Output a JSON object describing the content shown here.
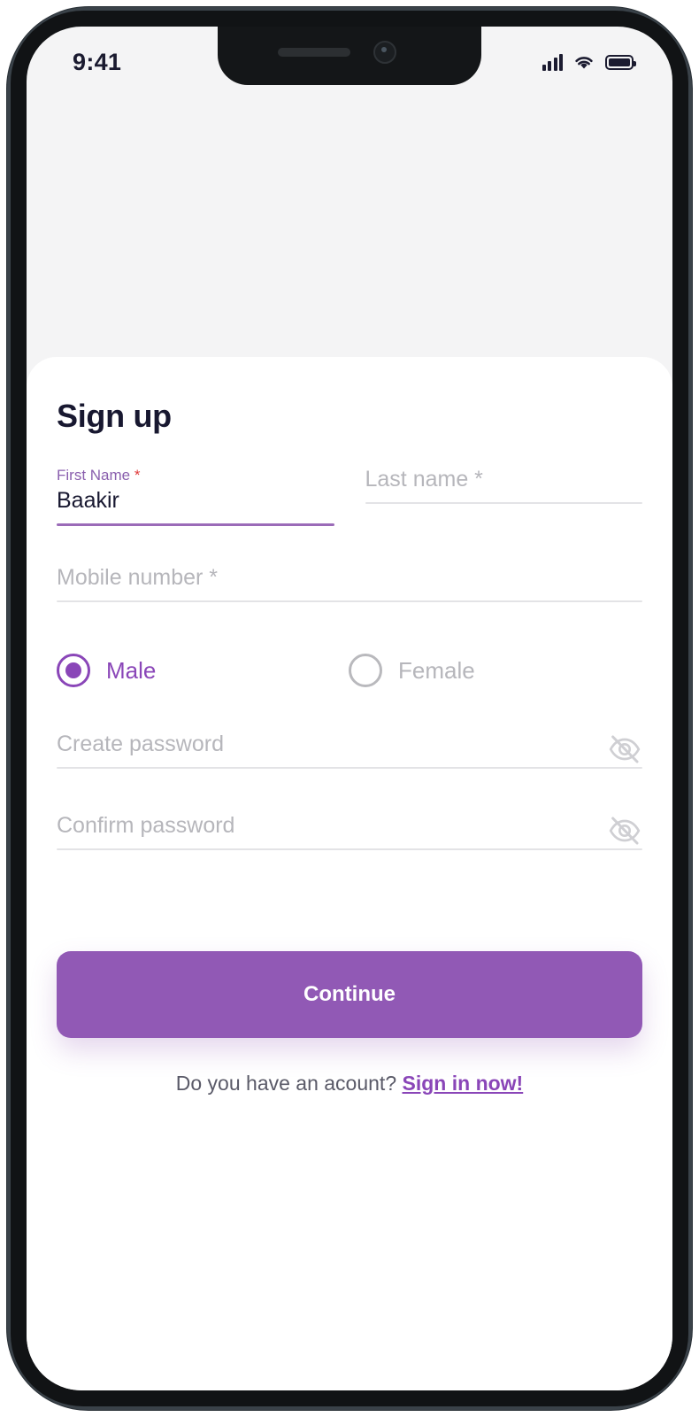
{
  "status_bar": {
    "time": "9:41",
    "signal_icon": "cellular-signal-icon",
    "wifi_icon": "wifi-icon",
    "battery_icon": "battery-full-icon"
  },
  "screen": {
    "title": "Sign up",
    "fields": {
      "first_name": {
        "label": "First Name",
        "required_marker": "*",
        "value": "Baakir",
        "state": "filled-active"
      },
      "last_name": {
        "placeholder": "Last name *",
        "value": "",
        "state": "empty"
      },
      "mobile_number": {
        "placeholder": "Mobile number *",
        "value": "",
        "state": "empty"
      },
      "create_password": {
        "placeholder": "Create password",
        "value": "",
        "toggle_icon": "eye-off-icon"
      },
      "confirm_password": {
        "placeholder": "Confirm password",
        "value": "",
        "toggle_icon": "eye-off-icon"
      }
    },
    "gender": {
      "selected": "Male",
      "options": [
        {
          "label": "Male",
          "checked": true
        },
        {
          "label": "Female",
          "checked": false
        }
      ]
    },
    "continue_label": "Continue",
    "footer": {
      "prompt": "Do you have an acount?",
      "link": "Sign in now!"
    }
  },
  "colors": {
    "accent_purple": "#8a46b8",
    "button_purple": "#9159b5",
    "label_purple": "#8a5fae",
    "active_underline": "#9b6bb8",
    "required_red": "#e03b3b",
    "title_navy": "#181830",
    "placeholder_grey": "#b6b6bb",
    "divider_grey": "#e3e3e6",
    "screen_bg": "#f4f4f5"
  }
}
